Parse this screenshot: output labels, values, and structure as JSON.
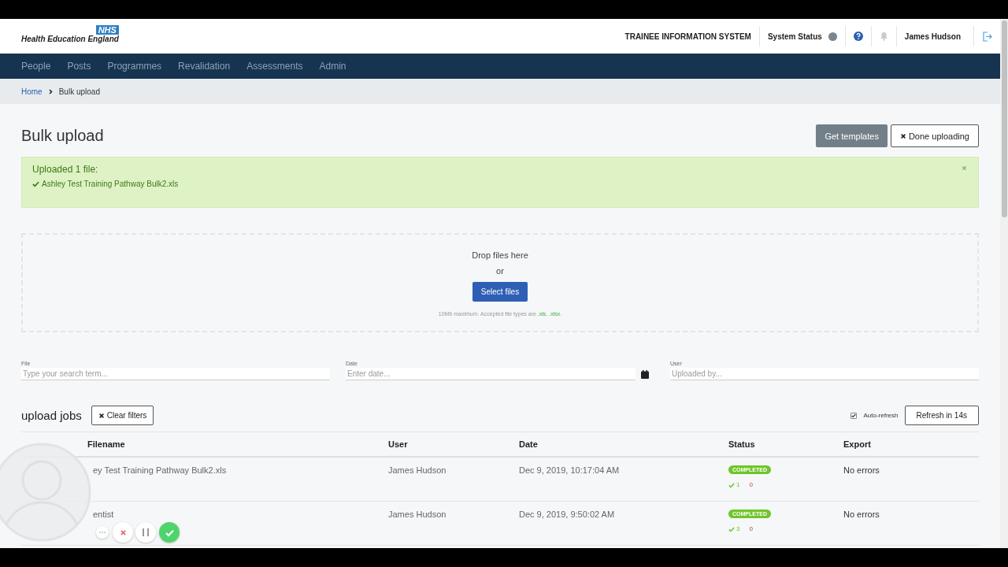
{
  "header": {
    "logo_badge": "NHS",
    "logo_text": "Health Education England",
    "system_name": "TRAINEE INFORMATION SYSTEM",
    "system_status": "System Status",
    "user": "James Hudson"
  },
  "nav": [
    "People",
    "Posts",
    "Programmes",
    "Revalidation",
    "Assessments",
    "Admin"
  ],
  "breadcrumb": [
    "Home",
    "Bulk upload"
  ],
  "page_title": "Bulk upload",
  "actions": [
    {
      "label": "Get templates",
      "kind": "secondary"
    },
    {
      "label": "Done uploading",
      "kind": "close"
    }
  ],
  "alert": {
    "title": "Uploaded 1 file:",
    "files": [
      "Ashley Test Training Pathway Bulk2.xls"
    ]
  },
  "dropzone": {
    "prompt": "Drop files here",
    "or": "or",
    "button": "Select files",
    "hint": "10Mb maximum. Accepted file types are **.xls**, **.xlsx**."
  },
  "filters": [
    {
      "label": "File",
      "placeholder": "Type your search term...",
      "kind": "text"
    },
    {
      "label": "Date",
      "placeholder": "Enter date...",
      "kind": "date"
    },
    {
      "label": "User",
      "placeholder": "Uploaded by...",
      "kind": "text"
    }
  ],
  "jobs": {
    "title": "upload jobs",
    "clear": "Clear filters",
    "auto_refresh": {
      "label": "Auto-refresh",
      "checked": true
    },
    "refresh": "Refresh in 14s",
    "columns": [
      "Filename",
      "User",
      "Date",
      "Status",
      "Export"
    ],
    "rows": [
      {
        "filename": "ey Test Training Pathway Bulk2.xls",
        "user": "James Hudson",
        "date": "Dec 9, 2019, 10:17:04 AM",
        "status": "COMPLETED",
        "success": "1",
        "errors": "0",
        "export": "No errors"
      },
      {
        "filename": "entist",
        "user": "James Hudson",
        "date": "Dec 9, 2019, 9:50:02 AM",
        "status": "COMPLETED",
        "success": "3",
        "errors": "0",
        "export": "No errors"
      }
    ]
  }
}
